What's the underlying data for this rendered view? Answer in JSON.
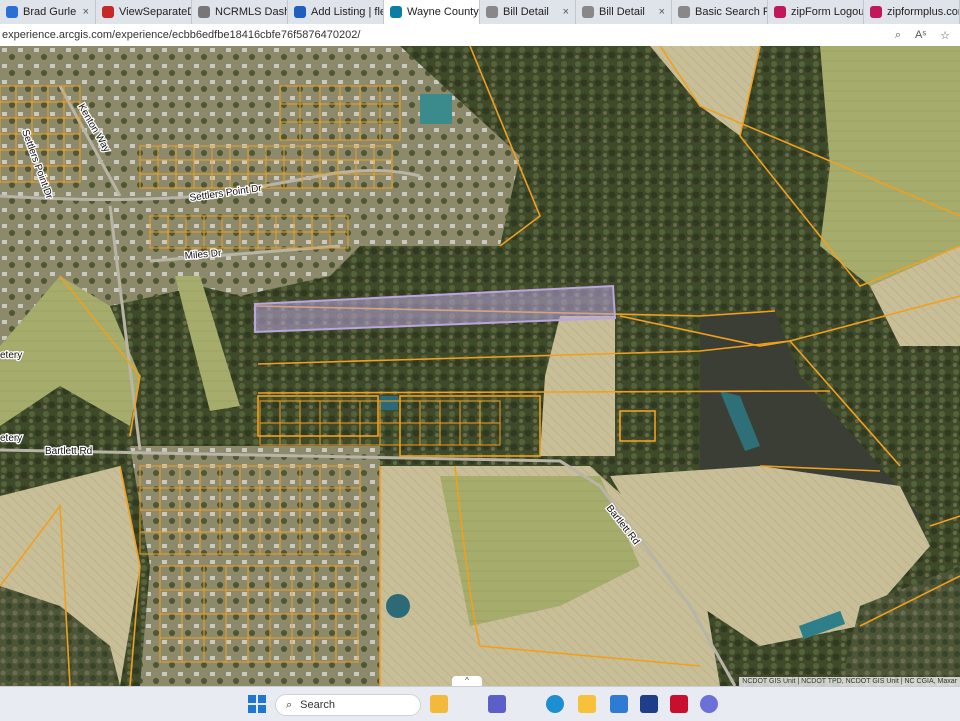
{
  "tabs": [
    {
      "label": "Brad Gurle",
      "color": "#2a6fd6",
      "active": false
    },
    {
      "label": "ViewSeparateDo",
      "color": "#c62828",
      "active": false
    },
    {
      "label": "NCRMLS Dashb",
      "color": "#777777",
      "active": false
    },
    {
      "label": "Add Listing | flex",
      "color": "#1f5fbf",
      "active": false
    },
    {
      "label": "Wayne County P",
      "color": "#0a7ea4",
      "active": true
    },
    {
      "label": "Bill Detail",
      "color": "#888888",
      "active": false
    },
    {
      "label": "Bill Detail",
      "color": "#888888",
      "active": false
    },
    {
      "label": "Basic Search Res",
      "color": "#888888",
      "active": false
    },
    {
      "label": "zipForm Logout",
      "color": "#c2185b",
      "active": false
    },
    {
      "label": "zipformplus.com",
      "color": "#c2185b",
      "active": false
    }
  ],
  "address": {
    "url": "experience.arcgis.com/experience/ecbb6edfbe18416cbfe76f5876470202/",
    "tools": [
      "zoom-icon",
      "read-aloud-icon",
      "favorite-icon"
    ]
  },
  "map": {
    "street_labels": {
      "kenton_way": "Kenton Way",
      "settlers_point_dr_1": "Settlers Point Dr",
      "settlers_point_dr_2": "Settlers Point Dr",
      "miles_dr": "Miles Dr",
      "bartlett_rd_1": "Bartlett Rd",
      "bartlett_rd_2": "Bartlett Rd",
      "cemetery_1": "etery",
      "cemetery_2": "etery"
    },
    "attribution": "NCDOT GIS Unit | NCDOT TPD, NCDOT GIS Unit | NC CGIA, Maxar",
    "parcel_color": "#f0a020",
    "selected_parcel_color": "#b9a6dc"
  },
  "taskbar": {
    "search_placeholder": "Search",
    "collapse_glyph": "^",
    "apps": [
      "file-explorer-icon",
      "teams-icon",
      "edge-icon",
      "folder-icon",
      "calculator-icon",
      "l-app-icon",
      "mcafee-icon",
      "copilot-icon"
    ]
  }
}
